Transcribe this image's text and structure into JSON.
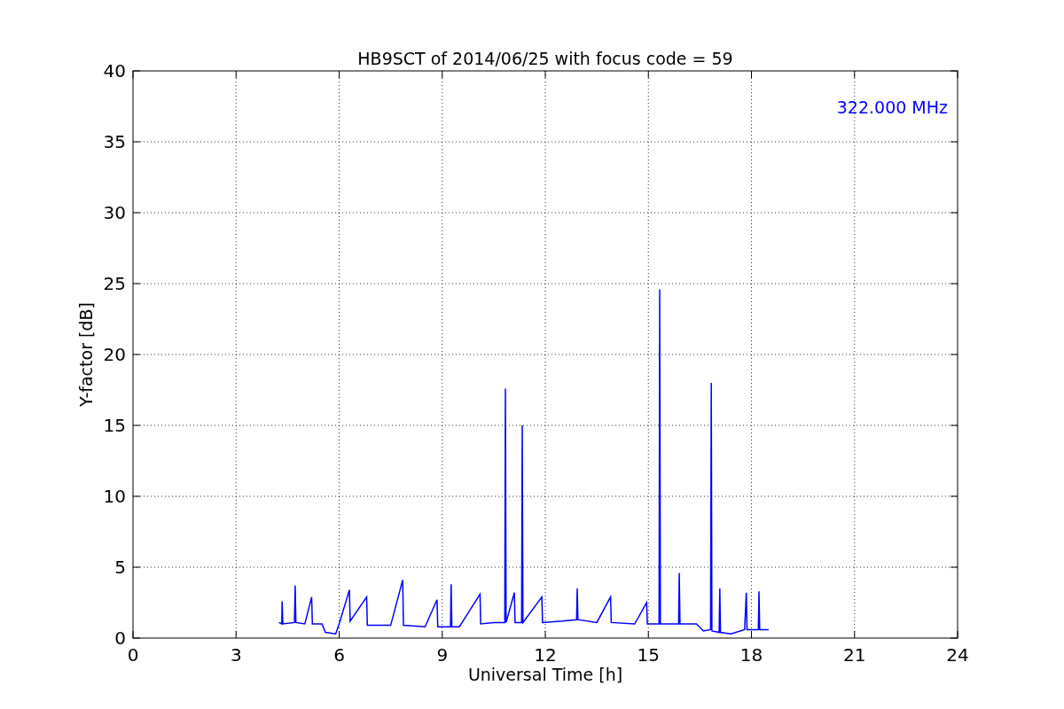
{
  "chart_data": {
    "type": "line",
    "title": "HB9SCT of 2014/06/25 with focus code = 59",
    "xlabel": "Universal Time [h]",
    "ylabel": "Y-factor [dB]",
    "xlim": [
      0,
      24
    ],
    "ylim": [
      0,
      40
    ],
    "xticks": [
      0,
      3,
      6,
      9,
      12,
      15,
      18,
      21,
      24
    ],
    "yticks": [
      0,
      5,
      10,
      15,
      20,
      25,
      30,
      35,
      40
    ],
    "series": [
      {
        "name": "322.000 MHz",
        "color": "#0000ff",
        "x": [
          4.25,
          4.33,
          4.34,
          4.36,
          4.7,
          4.72,
          4.74,
          5.0,
          5.2,
          5.22,
          5.5,
          5.6,
          5.9,
          6.0,
          6.3,
          6.32,
          6.8,
          6.82,
          7.5,
          7.85,
          7.87,
          8.5,
          8.85,
          8.87,
          9.24,
          9.26,
          9.28,
          9.5,
          10.1,
          10.12,
          10.5,
          10.82,
          10.84,
          10.86,
          11.1,
          11.12,
          11.31,
          11.33,
          11.35,
          11.9,
          11.92,
          12.5,
          12.91,
          12.93,
          12.95,
          13.5,
          13.9,
          13.92,
          14.6,
          14.95,
          14.97,
          15.31,
          15.33,
          15.35,
          15.88,
          15.9,
          15.92,
          16.4,
          16.6,
          16.81,
          16.83,
          16.85,
          17.06,
          17.08,
          17.1,
          17.4,
          17.8,
          17.85,
          17.87,
          18.2,
          18.22,
          18.24,
          18.5
        ],
        "values": [
          1.1,
          1.0,
          2.6,
          1.0,
          1.1,
          3.7,
          1.1,
          1.0,
          2.9,
          1.0,
          1.0,
          0.4,
          0.3,
          1.0,
          3.4,
          1.2,
          2.9,
          0.9,
          0.9,
          4.1,
          0.9,
          0.8,
          2.7,
          0.8,
          0.8,
          3.8,
          0.8,
          0.8,
          3.1,
          1.0,
          1.1,
          1.1,
          17.6,
          1.1,
          3.2,
          1.1,
          1.1,
          15.0,
          1.1,
          2.9,
          1.1,
          1.2,
          1.3,
          3.5,
          1.3,
          1.1,
          2.9,
          1.1,
          1.0,
          2.5,
          1.0,
          1.0,
          24.6,
          1.0,
          1.0,
          4.6,
          1.0,
          1.0,
          0.5,
          0.6,
          18.0,
          0.5,
          0.4,
          3.5,
          0.4,
          0.3,
          0.6,
          3.2,
          0.6,
          0.6,
          3.3,
          0.6,
          0.6
        ]
      }
    ],
    "grid": true
  }
}
